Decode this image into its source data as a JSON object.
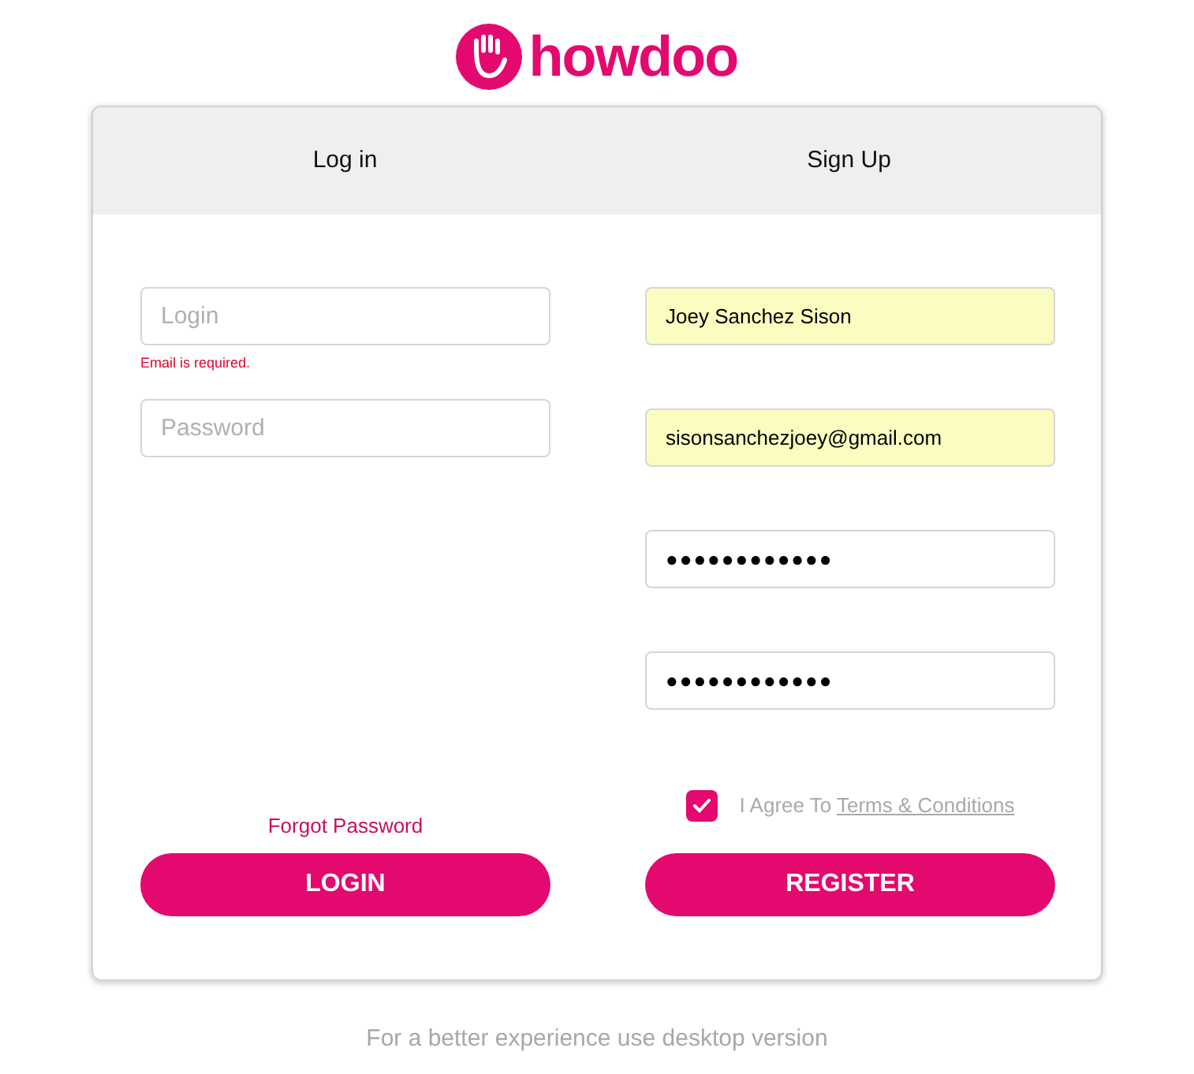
{
  "logo": {
    "text": "howdoo"
  },
  "tabs": [
    {
      "label": "Log in"
    },
    {
      "label": "Sign Up"
    }
  ],
  "login": {
    "fields": [
      {
        "placeholder": "Login",
        "error": "Email is required."
      },
      {
        "placeholder": "Password"
      }
    ],
    "forgot_link": "Forgot Password",
    "button": "LOGIN"
  },
  "signup": {
    "fields": [
      {
        "value": "Joey Sanchez Sison",
        "autofilled": true
      },
      {
        "value": "sisonsanchezjoey@gmail.com",
        "autofilled": true
      },
      {
        "value": "●●●●●●●●●●●●",
        "autofilled": false
      },
      {
        "value": "●●●●●●●●●●●●",
        "autofilled": false
      }
    ],
    "agree": {
      "checked": true,
      "text": "I Agree To",
      "link": "Terms & Conditions"
    },
    "button": "REGISTER"
  },
  "footer": "For a better experience use desktop version"
}
